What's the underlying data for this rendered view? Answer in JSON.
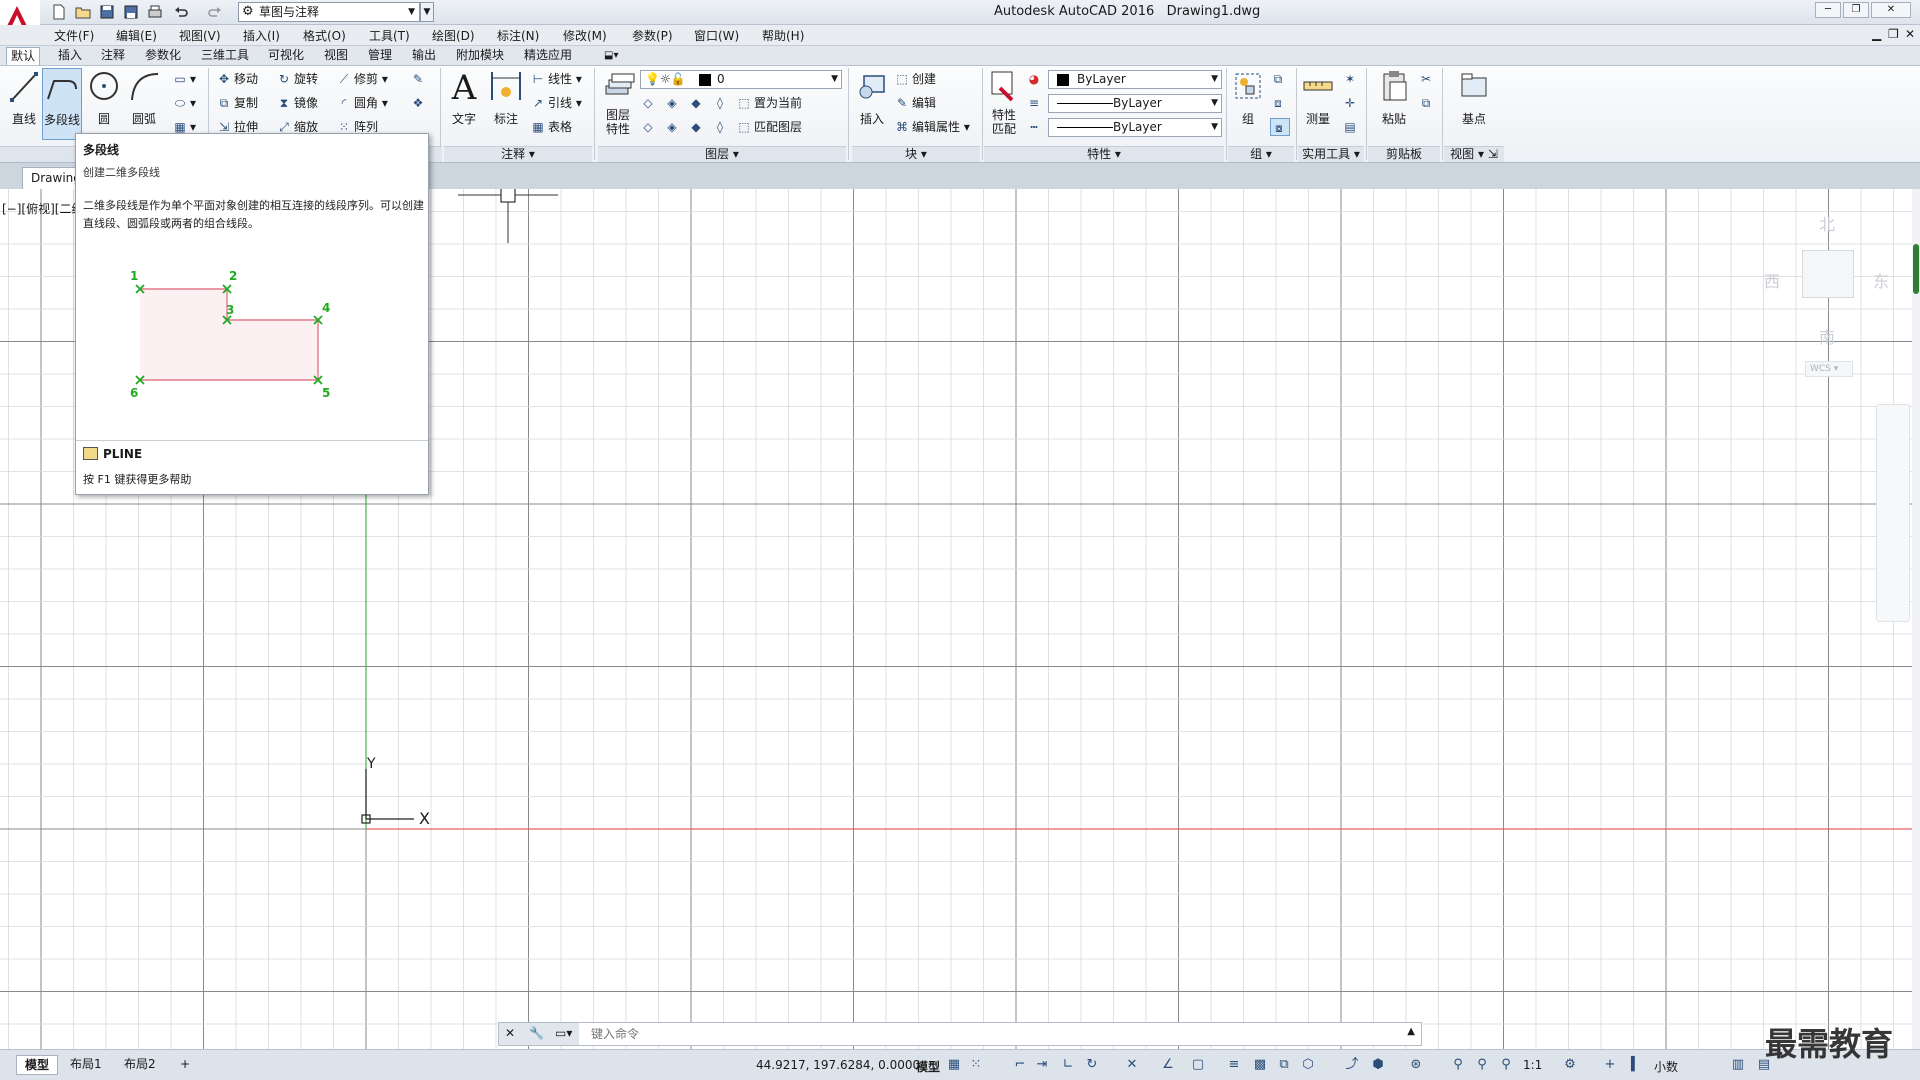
{
  "title_bar": {
    "app_title": "Autodesk AutoCAD 2016",
    "file_name": "Drawing1.dwg",
    "workspace": "草图与注释"
  },
  "menu": [
    "文件(F)",
    "编辑(E)",
    "视图(V)",
    "插入(I)",
    "格式(O)",
    "工具(T)",
    "绘图(D)",
    "标注(N)",
    "修改(M)",
    "参数(P)",
    "窗口(W)",
    "帮助(H)"
  ],
  "ribbon_tabs": [
    "默认",
    "插入",
    "注释",
    "参数化",
    "三维工具",
    "可视化",
    "视图",
    "管理",
    "输出",
    "附加模块",
    "精选应用"
  ],
  "draw_panel": {
    "line": "直线",
    "polyline": "多段线",
    "circle": "圆",
    "arc": "圆弧"
  },
  "modify_panel": {
    "move": "移动",
    "rotate": "旋转",
    "trim": "修剪",
    "copy": "复制",
    "mirror": "镜像",
    "fillet": "圆角",
    "stretch": "拉伸",
    "scale": "缩放",
    "array": "阵列"
  },
  "annotation_panel": {
    "text": "文字",
    "dimension": "标注",
    "linear": "线性",
    "leader": "引线",
    "table": "表格",
    "footer": "注释"
  },
  "layers_panel": {
    "layer_properties": "图层特性",
    "current_layer": "0",
    "make_current": "置为当前",
    "match_layer": "匹配图层",
    "footer": "图层"
  },
  "block_panel": {
    "insert": "插入",
    "create": "创建",
    "edit": "编辑",
    "edit_attributes": "编辑属性",
    "footer": "块"
  },
  "properties_panel": {
    "match_properties": "特性匹配",
    "color": "ByLayer",
    "linetype": "ByLayer",
    "lineweight": "ByLayer",
    "footer": "特性"
  },
  "group_panel": {
    "group": "组",
    "footer": "组"
  },
  "utilities_panel": {
    "measure": "测量",
    "footer": "实用工具"
  },
  "clipboard_panel": {
    "paste": "粘贴",
    "footer": "剪贴板"
  },
  "view_panel": {
    "base": "基点",
    "footer": "视图"
  },
  "file_tab": "Drawing",
  "viewport_label": "[−][俯视][二维",
  "viewcube": {
    "north": "北",
    "south": "南",
    "east": "东",
    "west": "西",
    "wcs": "WCS"
  },
  "tooltip": {
    "title": "多段线",
    "subtitle": "创建二维多段线",
    "description": "二维多段线是作为单个平面对象创建的相互连接的线段序列。可以创建直线段、圆弧段或两者的组合线段。",
    "point_labels": [
      "1",
      "2",
      "3",
      "4",
      "5",
      "6"
    ],
    "command": "PLINE",
    "help": "按 F1 键获得更多帮助"
  },
  "ucs": {
    "x": "X",
    "y": "Y"
  },
  "command_line": {
    "placeholder": "键入命令"
  },
  "layout_tabs": [
    "模型",
    "布局1",
    "布局2",
    "+"
  ],
  "status": {
    "coords": "44.9217, 197.6284, 0.0000",
    "mode": "模型",
    "scale": "1:1",
    "units": "小数"
  },
  "watermark": "最需教育",
  "colors": {
    "accent": "#d12d2d",
    "x_axis": "#e06060",
    "y_axis": "#4caf50",
    "grid_minor": "#d8d8d8",
    "grid_major": "#8a8a8a",
    "tooltip_vertex": "#22aa22"
  }
}
